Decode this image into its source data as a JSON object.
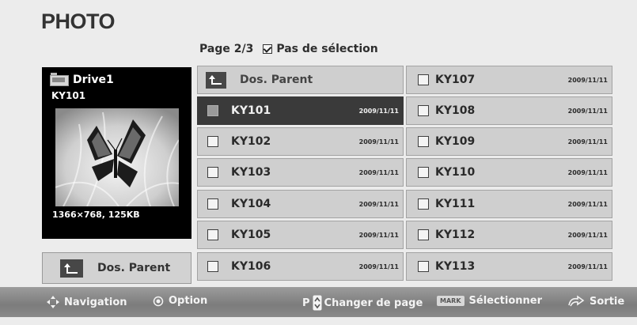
{
  "title": "PHOTO",
  "page": {
    "label": "Page 2/3",
    "selection_label": "Pas de sélection"
  },
  "preview": {
    "drive": "Drive1",
    "file": "KY101",
    "info": "1366×768, 125KB"
  },
  "parent_button": "Dos. Parent",
  "grid": {
    "left": [
      {
        "name": "Dos. Parent",
        "date": "",
        "type": "parent"
      },
      {
        "name": "KY101",
        "date": "2009/11/11",
        "selected": true
      },
      {
        "name": "KY102",
        "date": "2009/11/11"
      },
      {
        "name": "KY103",
        "date": "2009/11/11"
      },
      {
        "name": "KY104",
        "date": "2009/11/11"
      },
      {
        "name": "KY105",
        "date": "2009/11/11"
      },
      {
        "name": "KY106",
        "date": "2009/11/11"
      }
    ],
    "right": [
      {
        "name": "KY107",
        "date": "2009/11/11"
      },
      {
        "name": "KY108",
        "date": "2009/11/11"
      },
      {
        "name": "KY109",
        "date": "2009/11/11"
      },
      {
        "name": "KY110",
        "date": "2009/11/11"
      },
      {
        "name": "KY111",
        "date": "2009/11/11"
      },
      {
        "name": "KY112",
        "date": "2009/11/11"
      },
      {
        "name": "KY113",
        "date": "2009/11/11"
      }
    ]
  },
  "footer": {
    "navigation": "Navigation",
    "option": "Option",
    "page_key": "P",
    "change_page": "Changer de page",
    "mark_key": "MARK",
    "select": "Sélectionner",
    "exit": "Sortie"
  }
}
